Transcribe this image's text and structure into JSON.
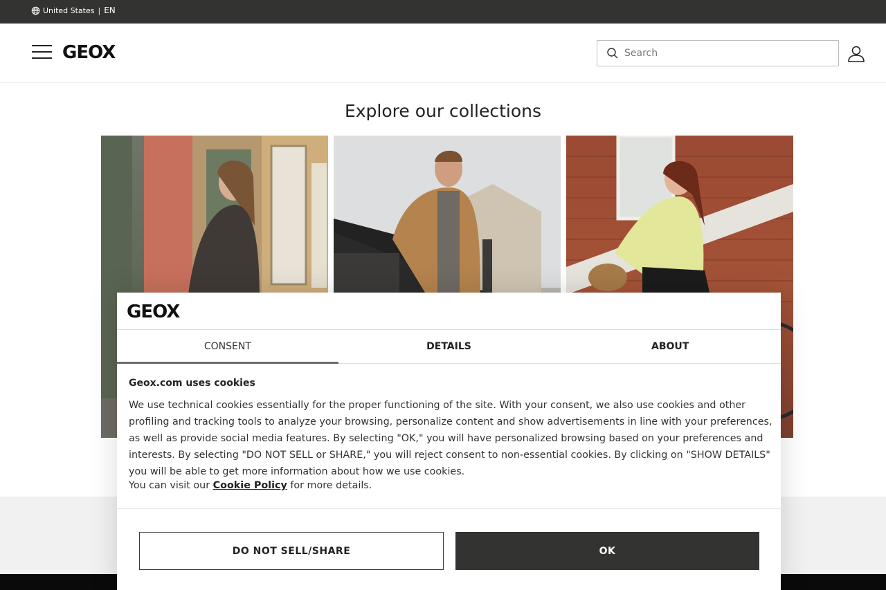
{
  "topbar": {
    "country": "United States",
    "separator": "|",
    "language": "EN"
  },
  "header": {
    "brand": "GEOX",
    "search_placeholder": "Search"
  },
  "main": {
    "explore_title": "Explore our collections"
  },
  "consent_modal": {
    "brand": "GEOX",
    "tabs": [
      {
        "label": "CONSENT",
        "active": true
      },
      {
        "label": "DETAILS",
        "active": false
      },
      {
        "label": "ABOUT",
        "active": false
      }
    ],
    "title": "Geox.com uses cookies",
    "body": "We use technical cookies essentially for the proper functioning of the site. With your consent, we also use cookies and other profiling and tracking tools to analyze your browsing, personalize content and show advertisements in line with your preferences, as well as provide social media features. By selecting \"OK,\" you will have personalized browsing based on your preferences and interests. By selecting \"DO NOT SELL or SHARE,\" you will reject consent to non-essential cookies. By clicking on \"SHOW DETAILS\" you will be able to get more information about how we use cookies.",
    "visit_prefix": "You can visit our",
    "cookie_policy_link": "Cookie Policy",
    "visit_suffix": "for more details.",
    "reject_button": "DO NOT SELL/SHARE",
    "ok_button": "OK"
  },
  "colors": {
    "topbar_bg": "#333432",
    "primary_button": "#333432",
    "footer_band": "#0a0a0a"
  }
}
